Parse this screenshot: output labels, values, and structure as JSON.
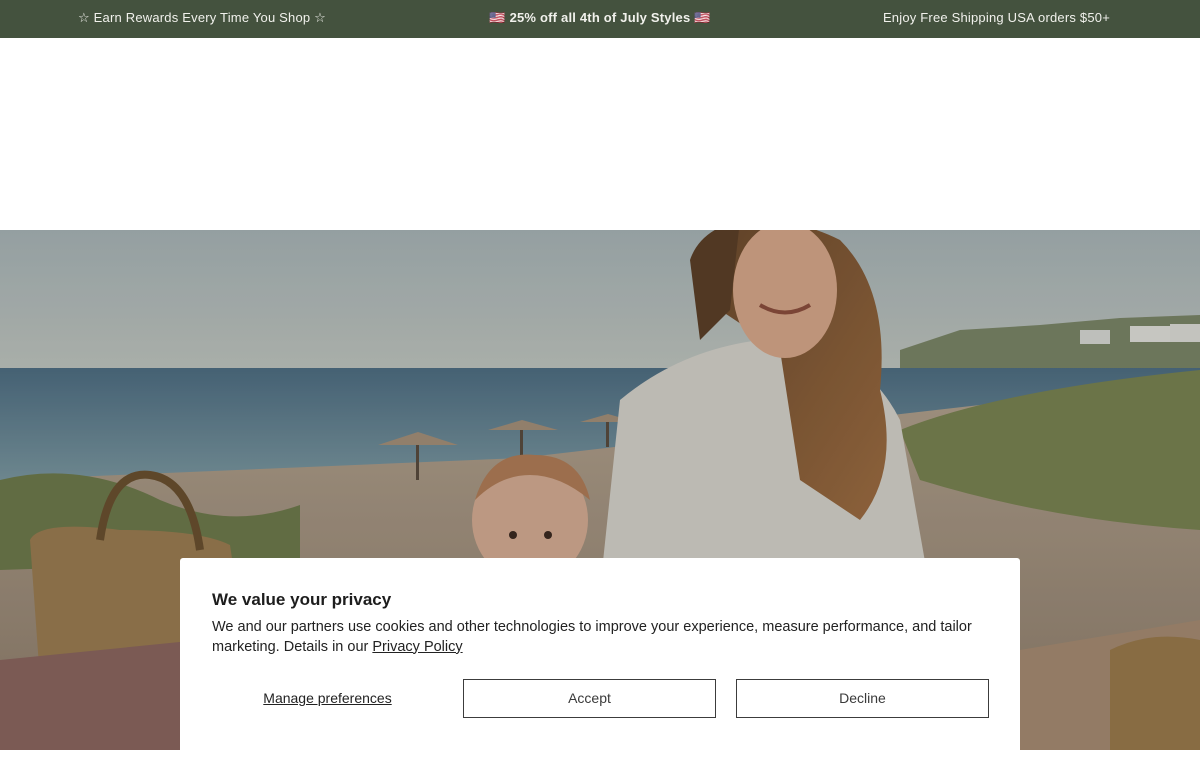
{
  "announcement": {
    "left": "☆ Earn Rewards Every Time You Shop ☆",
    "center": "🇺🇸 25% off all 4th of July Styles 🇺🇸",
    "right": "Enjoy Free Shipping USA orders $50+",
    "background": "#44523e"
  },
  "hero": {
    "image_icon": "beach-mother-baby-photo"
  },
  "cookie_banner": {
    "title": "We value your privacy",
    "body_text": "We and our partners use cookies and other technologies to improve your experience, measure performance, and tailor marketing. Details in our ",
    "privacy_link": "Privacy Policy",
    "manage_label": "Manage preferences",
    "accept_label": "Accept",
    "decline_label": "Decline"
  }
}
